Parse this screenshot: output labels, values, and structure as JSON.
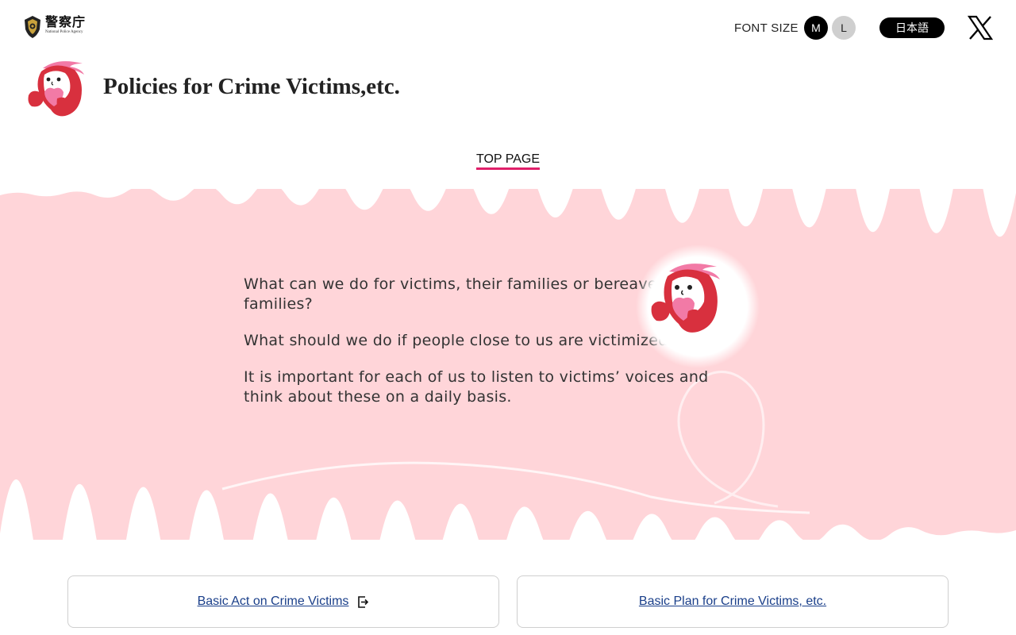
{
  "header": {
    "logo_jp": "警察庁",
    "logo_en": "National Police Agency",
    "font_size_label": "FONT SIZE",
    "font_size_options": [
      "M",
      "L"
    ],
    "language_button": "日本語",
    "social_icon": "x-logo-icon"
  },
  "site": {
    "title": "Policies for Crime Victims,etc.",
    "mascot_icon": "mascot-heart-icon"
  },
  "nav": {
    "top_page": "TOP PAGE"
  },
  "hero": {
    "paragraphs": [
      "What can we do for victims, their families or bereaved families?",
      "What should we do if people close to us are victimized?",
      "It is important for each of us to listen to victims’ voices and think about these on a daily basis."
    ]
  },
  "links": [
    {
      "label": "Basic Act on Crime Victims",
      "icon": "external-link-icon"
    },
    {
      "label": "Basic Plan for Crime Victims, etc."
    }
  ],
  "colors": {
    "accent_pink": "#e0206a",
    "hero_bg": "#ffd5d9",
    "link_blue": "#1a3f8a",
    "mascot_red": "#d8303e",
    "mascot_pink": "#f27aa6"
  }
}
